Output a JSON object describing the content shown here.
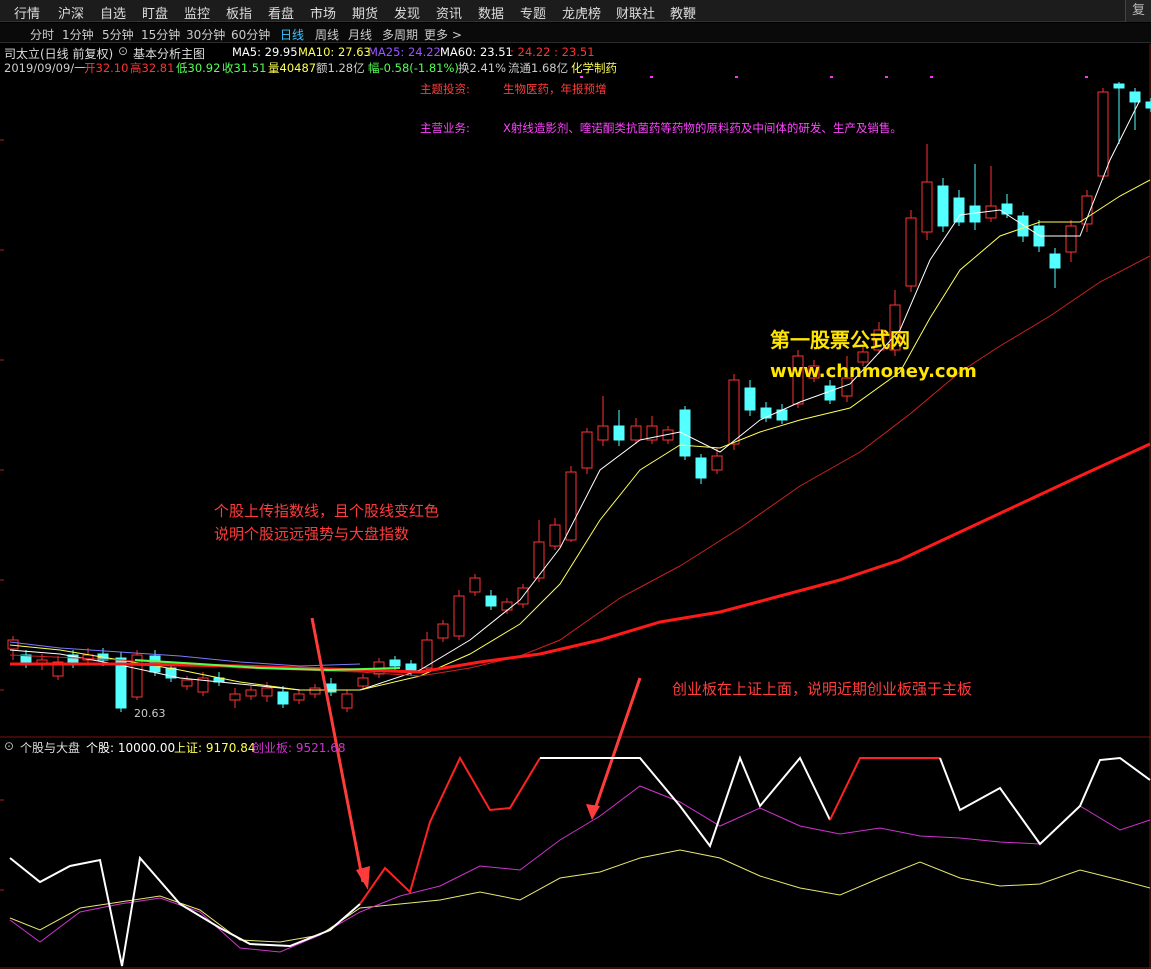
{
  "menu": [
    "行情",
    "沪深",
    "自选",
    "盯盘",
    "监控",
    "板指",
    "看盘",
    "市场",
    "期货",
    "发现",
    "资讯",
    "数据",
    "专题",
    "龙虎榜",
    "财联社",
    "教鞭"
  ],
  "menu_right": "复权",
  "periods": [
    "分时",
    "1分钟",
    "5分钟",
    "15分钟",
    "30分钟",
    "60分钟",
    "日线",
    "周线",
    "月线",
    "多周期",
    "更多 >"
  ],
  "active_period": "日线",
  "stock": {
    "title": "司太立(日线 前复权)",
    "main_chart": "基本分析主图",
    "ma5": "MA5: 29.95",
    "ma10": "MA10: 27.63",
    "ma25": "MA25: 24.22",
    "ma60": "MA60: 23.51",
    "extra": ": 24.22 : 23.51",
    "date": "2019/09/09/一",
    "open": "开32.10",
    "high": "高32.81",
    "low": "低30.92",
    "close": "收31.51",
    "volume": "量40487",
    "amount": "额1.28亿",
    "change": "幅-0.58(-1.81%)",
    "turnover": "换2.41%",
    "float": "流通1.68亿",
    "industry": "化学制药"
  },
  "info": {
    "theme_label": "主题投资:",
    "theme_value": "生物医药，年报预增",
    "biz_label": "主营业务:",
    "biz_value": "X射线造影剂、喹诺酮类抗菌药等药物的原料药及中间体的研发、生产及销售。"
  },
  "watermark": {
    "line1": "第一股票公式网",
    "line2": "www.chnmoney.com"
  },
  "min_label": "20.63",
  "annotations": {
    "left_line1": "个股上传指数线，且个股线变红色",
    "left_line2": "说明个股远远强势与大盘指数",
    "right": "创业板在上证上面，说明近期创业板强于主板"
  },
  "indicator": {
    "name": "个股与大盘",
    "stock": "个股: 10000.00",
    "sh": "上证: 9170.84",
    "cyb": "创业板: 9521.68"
  },
  "colors": {
    "up": "#ff3333",
    "down": "#54ffff",
    "ma5": "#ffffff",
    "ma10": "#ffff55",
    "ma25": "#cc2222",
    "ma60": "#ff1a1a",
    "cyb": "#d033d0",
    "sh": "#e8e870",
    "label_red": "#ff3c3c",
    "label_magenta": "#ff44ff",
    "watermark": "#ffe500"
  }
}
